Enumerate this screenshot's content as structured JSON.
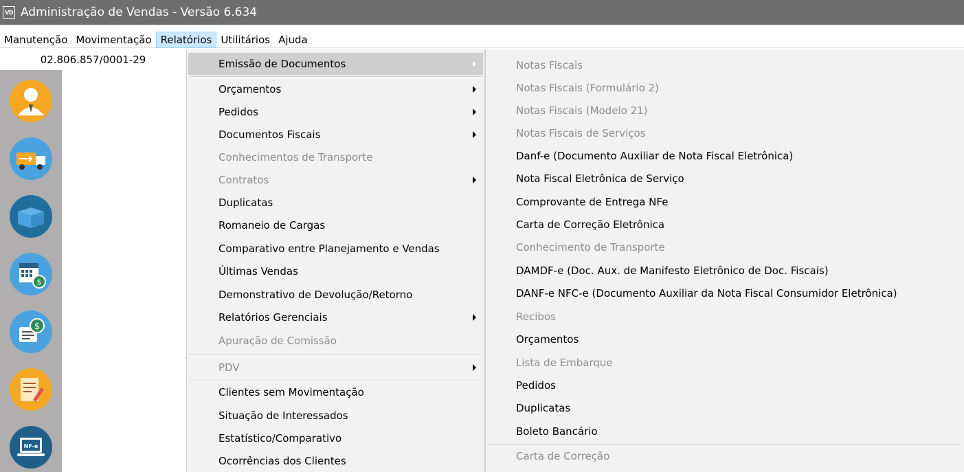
{
  "window": {
    "icon_text": "VD",
    "title": "Administração de Vendas - Versão 6.634"
  },
  "menubar": {
    "items": [
      "Manutenção",
      "Movimentação",
      "Relatórios",
      "Utilitários",
      "Ajuda"
    ],
    "active": "Relatórios"
  },
  "cnpj": "02.806.857/0001-29",
  "sidebar": {
    "buttons": [
      {
        "icon": "customer-icon",
        "color": "#f5a623"
      },
      {
        "icon": "truck-icon",
        "color": "#4aa3df"
      },
      {
        "icon": "box-icon",
        "color": "#2a7fb0"
      },
      {
        "icon": "calendar-money-icon",
        "color": "#4aa3df"
      },
      {
        "icon": "money-document-icon",
        "color": "#4aa3df"
      },
      {
        "icon": "document-edit-icon",
        "color": "#f5a623"
      },
      {
        "icon": "nfe-laptop-icon",
        "color": "#2a7fb0"
      }
    ],
    "nfe_label": "NF-e"
  },
  "relatorios_menu": {
    "items": [
      {
        "label": "Emissão de Documentos",
        "submenu": true,
        "disabled": false,
        "highlight": true
      },
      {
        "label": "Orçamentos",
        "submenu": true,
        "disabled": false
      },
      {
        "label": "Pedidos",
        "submenu": true,
        "disabled": false
      },
      {
        "label": "Documentos Fiscais",
        "submenu": true,
        "disabled": false
      },
      {
        "label": "Conhecimentos de Transporte",
        "submenu": false,
        "disabled": true
      },
      {
        "label": "Contratos",
        "submenu": true,
        "disabled": true
      },
      {
        "label": "Duplicatas",
        "submenu": false,
        "disabled": false
      },
      {
        "label": "Romaneio de Cargas",
        "submenu": false,
        "disabled": false
      },
      {
        "label": "Comparativo entre Planejamento e Vendas",
        "submenu": false,
        "disabled": false
      },
      {
        "label": "Últimas Vendas",
        "submenu": false,
        "disabled": false
      },
      {
        "label": "Demonstrativo de Devolução/Retorno",
        "submenu": false,
        "disabled": false
      },
      {
        "label": "Relatórios Gerenciais",
        "submenu": true,
        "disabled": false
      },
      {
        "label": "Apuração de Comissão",
        "submenu": false,
        "disabled": true
      },
      {
        "label": "PDV",
        "submenu": true,
        "disabled": true
      },
      {
        "label": "Clientes sem Movimentação",
        "submenu": false,
        "disabled": false
      },
      {
        "label": "Situação de Interessados",
        "submenu": false,
        "disabled": false
      },
      {
        "label": "Estatístico/Comparativo",
        "submenu": false,
        "disabled": false
      },
      {
        "label": "Ocorrências dos Clientes",
        "submenu": false,
        "disabled": false
      }
    ]
  },
  "emissao_submenu": {
    "items": [
      {
        "label": "Notas Fiscais",
        "disabled": true
      },
      {
        "label": "Notas Fiscais (Formulário 2)",
        "disabled": true
      },
      {
        "label": "Notas Fiscais (Modelo 21)",
        "disabled": true
      },
      {
        "label": "Notas Fiscais de Serviços",
        "disabled": true
      },
      {
        "label": "Danf-e (Documento Auxiliar de Nota Fiscal Eletrônica)",
        "disabled": false
      },
      {
        "label": "Nota Fiscal Eletrônica de Serviço",
        "disabled": false
      },
      {
        "label": "Comprovante de Entrega NFe",
        "disabled": false
      },
      {
        "label": "Carta de Correção Eletrônica",
        "disabled": false
      },
      {
        "label": "Conhecimento de Transporte",
        "disabled": true
      },
      {
        "label": "DAMDF-e (Doc. Aux. de Manifesto Eletrônico de Doc. Fiscais)",
        "disabled": false
      },
      {
        "label": "DANF-e NFC-e (Documento Auxiliar da Nota Fiscal Consumidor Eletrônica)",
        "disabled": false
      },
      {
        "label": "Recibos",
        "disabled": true
      },
      {
        "label": "Orçamentos",
        "disabled": false
      },
      {
        "label": "Lista de Embarque",
        "disabled": true
      },
      {
        "label": "Pedidos",
        "disabled": false
      },
      {
        "label": "Duplicatas",
        "disabled": false
      },
      {
        "label": "Boleto Bancário",
        "disabled": false
      },
      {
        "label": "Carta de Correção",
        "disabled": true
      }
    ]
  }
}
